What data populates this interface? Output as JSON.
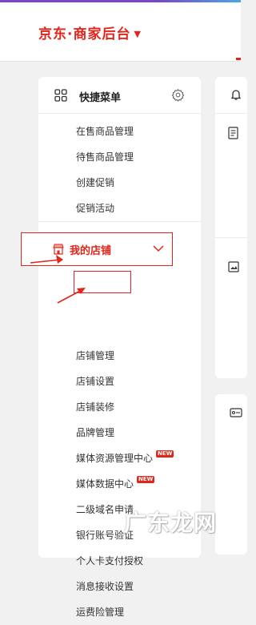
{
  "header": {
    "brand": "京东·商家后台",
    "brand_caret": "▼"
  },
  "quick_menu": {
    "title": "快捷菜单",
    "items": [
      {
        "label": "在售商品管理"
      },
      {
        "label": "待售商品管理"
      },
      {
        "label": "创建促销"
      },
      {
        "label": "促销活动"
      }
    ]
  },
  "store_menu": {
    "title": "我的店铺",
    "items": [
      {
        "label": "店铺管理"
      },
      {
        "label": "店铺设置"
      },
      {
        "label": "店铺装修"
      },
      {
        "label": "品牌管理"
      },
      {
        "label": "媒体资源管理中心",
        "badge": "NEW"
      },
      {
        "label": "媒体数据中心",
        "badge": "NEW"
      },
      {
        "label": "二级域名申请"
      },
      {
        "label": "银行账号验证"
      },
      {
        "label": "个人卡支付授权"
      },
      {
        "label": "消息接收设置"
      },
      {
        "label": "运费险管理"
      }
    ]
  },
  "colors": {
    "accent": "#e1251b",
    "topline_left": "#7a46c9",
    "topline_right": "#4aa6e8"
  },
  "watermark": "广东龙网"
}
